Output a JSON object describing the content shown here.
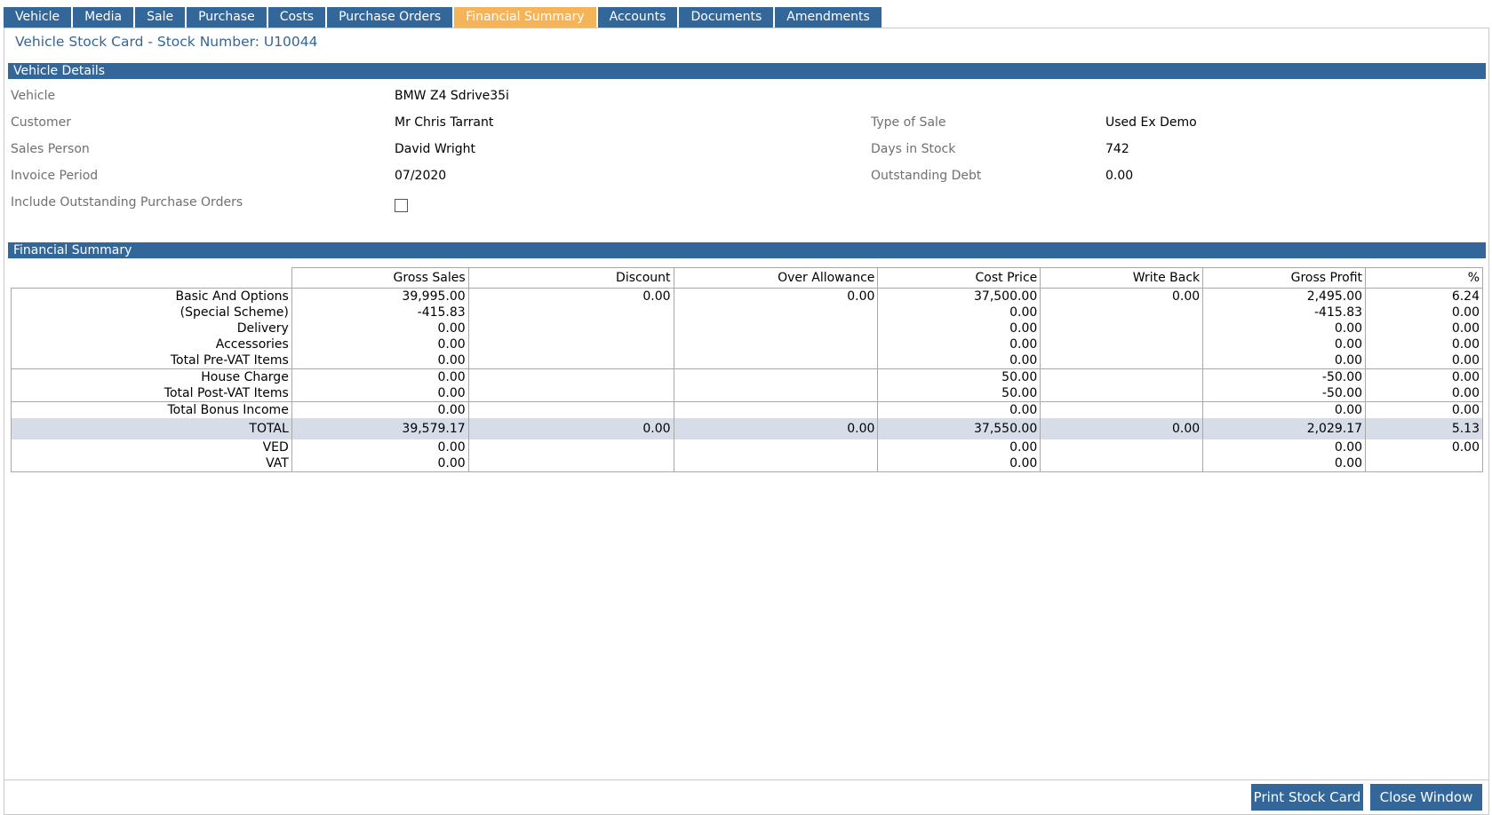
{
  "tabs": [
    {
      "label": "Vehicle",
      "active": false
    },
    {
      "label": "Media",
      "active": false
    },
    {
      "label": "Sale",
      "active": false
    },
    {
      "label": "Purchase",
      "active": false
    },
    {
      "label": "Costs",
      "active": false
    },
    {
      "label": "Purchase Orders",
      "active": false
    },
    {
      "label": "Financial Summary",
      "active": true
    },
    {
      "label": "Accounts",
      "active": false
    },
    {
      "label": "Documents",
      "active": false
    },
    {
      "label": "Amendments",
      "active": false
    }
  ],
  "card_title": "Vehicle Stock Card - Stock Number: U10044",
  "vehicle_details": {
    "header": "Vehicle Details",
    "vehicle_label": "Vehicle",
    "vehicle_value": "BMW Z4 Sdrive35i",
    "customer_label": "Customer",
    "customer_value": "Mr Chris Tarrant",
    "sales_person_label": "Sales Person",
    "sales_person_value": "David Wright",
    "invoice_period_label": "Invoice Period",
    "invoice_period_value": "07/2020",
    "include_po_label": "Include Outstanding Purchase Orders",
    "include_po_checked": false,
    "type_of_sale_label": "Type of Sale",
    "type_of_sale_value": "Used Ex Demo",
    "days_in_stock_label": "Days in Stock",
    "days_in_stock_value": "742",
    "outstanding_debt_label": "Outstanding Debt",
    "outstanding_debt_value": "0.00"
  },
  "financial_summary": {
    "header": "Financial Summary",
    "columns": [
      "",
      "Gross Sales",
      "Discount",
      "Over Allowance",
      "Cost Price",
      "Write Back",
      "Gross Profit",
      "%"
    ],
    "rows": [
      [
        "Basic And Options",
        "39,995.00",
        "0.00",
        "0.00",
        "37,500.00",
        "0.00",
        "2,495.00",
        "6.24"
      ],
      [
        "(Special Scheme)",
        "-415.83",
        "",
        "",
        "0.00",
        "",
        "-415.83",
        "0.00"
      ],
      [
        "Delivery",
        "0.00",
        "",
        "",
        "0.00",
        "",
        "0.00",
        "0.00"
      ],
      [
        "Accessories",
        "0.00",
        "",
        "",
        "0.00",
        "",
        "0.00",
        "0.00"
      ],
      [
        "Total Pre-VAT Items",
        "0.00",
        "",
        "",
        "0.00",
        "",
        "0.00",
        "0.00"
      ],
      [
        "House Charge",
        "0.00",
        "",
        "",
        "50.00",
        "",
        "-50.00",
        "0.00"
      ],
      [
        "Total Post-VAT Items",
        "0.00",
        "",
        "",
        "50.00",
        "",
        "-50.00",
        "0.00"
      ],
      [
        "Total Bonus Income",
        "0.00",
        "",
        "",
        "0.00",
        "",
        "0.00",
        "0.00"
      ],
      [
        "TOTAL",
        "39,579.17",
        "0.00",
        "0.00",
        "37,550.00",
        "0.00",
        "2,029.17",
        "5.13"
      ],
      [
        "VED",
        "0.00",
        "",
        "",
        "0.00",
        "",
        "0.00",
        "0.00"
      ],
      [
        "VAT",
        "0.00",
        "",
        "",
        "0.00",
        "",
        "0.00",
        ""
      ]
    ]
  },
  "buttons": {
    "print_label": "Print Stock Card",
    "close_label": "Close Window"
  }
}
